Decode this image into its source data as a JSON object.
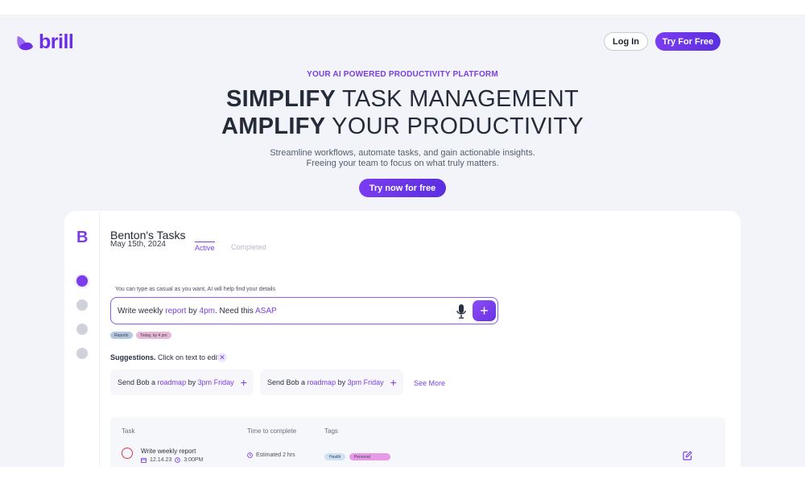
{
  "header": {
    "logo_text": "brill",
    "login_label": "Log In",
    "try_free_label": "Try For Free"
  },
  "hero": {
    "eyebrow": "YOUR AI POWERED PRODUCTIVITY PLATFORM",
    "line1_bold": "SIMPLIFY",
    "line1_light": " TASK MANAGEMENT",
    "line2_bold": "AMPLIFY",
    "line2_light": " YOUR PRODUCTIVITY",
    "subtitle_line1": "Streamline workflows, automate tasks, and gain actionable insights.",
    "subtitle_line2": "Freeing your team to focus on what truly matters.",
    "cta_label": "Try now for free"
  },
  "app": {
    "sidebar_logo": "B",
    "title": "Benton's Tasks",
    "date": "May 15th, 2024",
    "tabs": [
      {
        "label": "Active"
      },
      {
        "label": "Completed"
      }
    ],
    "hint": "You can type as casual as you want, AI will help find your details",
    "input": {
      "parts": [
        {
          "text": "Write weekly ",
          "highlight": false
        },
        {
          "text": "report",
          "highlight": true
        },
        {
          "text": " by ",
          "highlight": false
        },
        {
          "text": "4pm",
          "highlight": true
        },
        {
          "text": ". Need this ",
          "highlight": false
        },
        {
          "text": "ASAP",
          "highlight": true
        }
      ],
      "add_symbol": "+"
    },
    "detected_chips": [
      {
        "label": "Reports"
      },
      {
        "label": "Today, by 4 pm"
      }
    ],
    "suggestions": {
      "label_bold": "Suggestions.",
      "label_rest": " Click on text to edit",
      "close_symbol": "✕",
      "items": [
        {
          "pre": "Send Bob a ",
          "hl1": "roadmap",
          "mid": " by ",
          "hl2": "3pm Friday"
        },
        {
          "pre": "Send Bob a ",
          "hl1": "roadmap",
          "mid": " by ",
          "hl2": "3pm Friday"
        }
      ],
      "plus_symbol": "+",
      "see_more": "See More"
    },
    "table": {
      "headers": {
        "task": "Task",
        "time": "Time to complete",
        "tags": "Tags"
      },
      "rows": [
        {
          "task": "Write weekly report",
          "date": "12.14.23",
          "time": "3:00PM",
          "estimate": "Estimated 2 hrs",
          "tags": [
            "Health",
            "Personal"
          ]
        }
      ]
    }
  },
  "colors": {
    "accent": "#7b3cf0",
    "background": "#f2f4fa",
    "card": "#ffffff",
    "task_circle": "#d9364f"
  },
  "icons": [
    "brill-logo-icon",
    "microphone-icon",
    "plus-icon",
    "close-icon",
    "calendar-icon",
    "clock-icon",
    "edit-icon"
  ]
}
